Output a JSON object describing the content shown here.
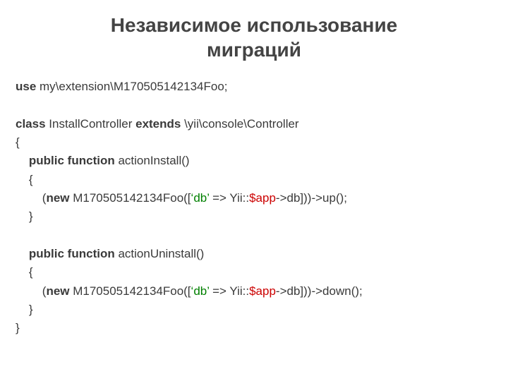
{
  "title_line1": "Независимое использование",
  "title_line2": "миграций",
  "code": {
    "kw_use": "use",
    "use_path": " my\\extension\\M170505142134Foo;",
    "kw_class": "class",
    "class_name": " InstallController ",
    "kw_extends": "extends",
    "base_class": " \\yii\\console\\Controller",
    "brace_open": "{",
    "indent1": "    ",
    "kw_pubfunc1": "public function",
    "fn1_name": " actionInstall()",
    "fn_brace_open": "    {",
    "line_install_1": "        (",
    "kw_new1": "new",
    "line_install_2": " M170505142134Foo([",
    "str_db1": "‘db’",
    "line_install_3": " => Yii::",
    "var_app1": "$app",
    "line_install_4": "->db]))->up();",
    "fn_brace_close": "    }",
    "kw_pubfunc2": "public function",
    "fn2_name": " actionUninstall()",
    "line_uninstall_1": "        (",
    "kw_new2": "new",
    "line_uninstall_2": " M170505142134Foo([",
    "str_db2": "‘db’",
    "line_uninstall_3": " => Yii::",
    "var_app2": "$app",
    "line_uninstall_4": "->db]))->down();",
    "brace_close": "}"
  }
}
